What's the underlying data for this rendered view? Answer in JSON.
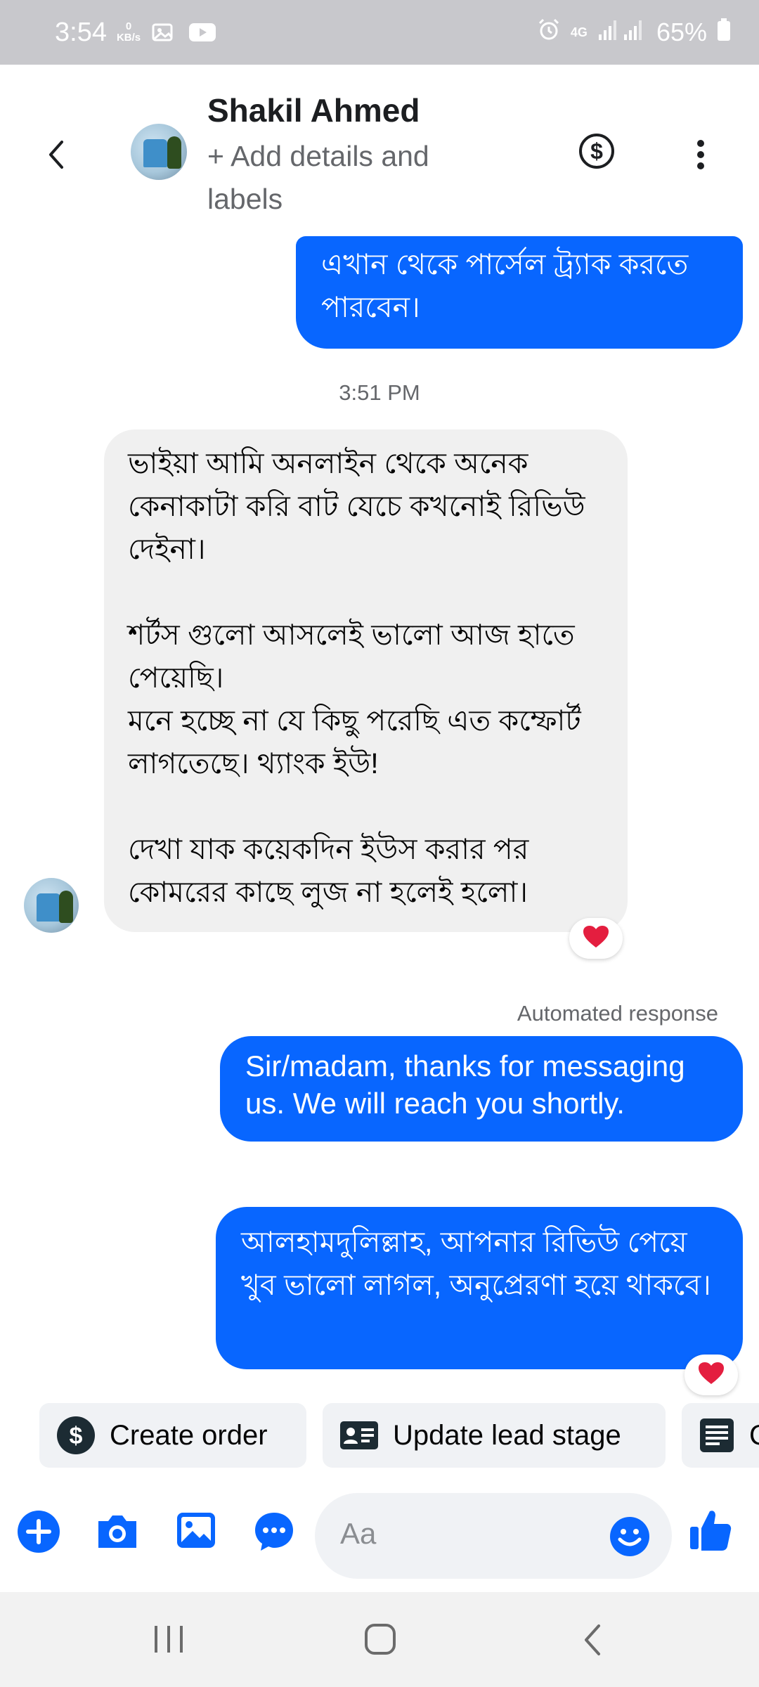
{
  "status_bar": {
    "time": "3:54",
    "net_speed_value": "0",
    "net_speed_unit": "KB/s",
    "network_label": "4G",
    "battery": "65%"
  },
  "header": {
    "contact_name": "Shakil Ahmed",
    "subtitle": "+ Add details and labels",
    "dollar_symbol": "$"
  },
  "messages": {
    "outgoing_1": "এখান থেকে পার্সেল ট্র্যাক করতে পারবেন।",
    "timestamp": "3:51 PM",
    "incoming_1_para_1": "ভাইয়া আমি অনলাইন থেকে অনেক কেনাকাটা করি বাট যেচে কখনোই রিভিউ দেইনা।",
    "incoming_1_para_2": "শর্টস গুলো আসলেই ভালো আজ হাতে পেয়েছি।\nমনে হচ্ছে না যে কিছু পরেছি এত কম্ফোর্ট লাগতেছে। থ্যাংক ইউ!",
    "incoming_1_para_3": "দেখা যাক কয়েকদিন ইউস করার পর কোমরের কাছে লুজ না হলেই হলো।",
    "automated_label": "Automated response",
    "outgoing_2": "Sir/madam, thanks for messaging us. We will reach you shortly.",
    "outgoing_3": "আলহামদুলিল্লাহ, আপনার রিভিউ পেয়ে খুব ভালো লাগল, অনুপ্রেরণা হয়ে থাকবে।"
  },
  "quick_actions": {
    "create_order": "Create order",
    "update_lead_stage": "Update lead stage",
    "third_partial": "C"
  },
  "composer": {
    "placeholder": "Aa"
  },
  "colors": {
    "accent": "#0866ff",
    "reaction_heart": "#e41e3f"
  },
  "icons": [
    "back-arrow-icon",
    "dollar-circle-icon",
    "more-vertical-icon",
    "heart-icon",
    "plus-icon",
    "camera-icon",
    "gallery-icon",
    "chat-bubble-icon",
    "emoji-icon",
    "like-icon",
    "recents-icon",
    "home-icon",
    "nav-back-icon"
  ]
}
